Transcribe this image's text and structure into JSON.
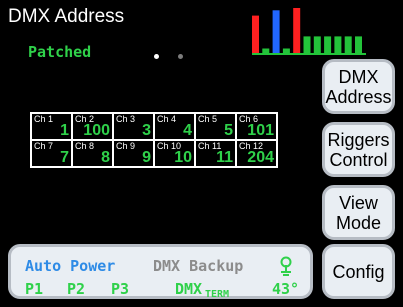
{
  "header": {
    "title": "DMX Address",
    "status": "Patched"
  },
  "page_dots": {
    "count": 2,
    "active": 0
  },
  "level_bars": [
    {
      "level": 0.83,
      "color": "#ff2020"
    },
    {
      "level": 0.1,
      "color": "#23c43a"
    },
    {
      "level": 0.95,
      "color": "#2166ff"
    },
    {
      "level": 0.1,
      "color": "#23c43a"
    },
    {
      "level": 1.0,
      "color": "#ff2020"
    },
    {
      "level": 0.37,
      "color": "#23c43a"
    },
    {
      "level": 0.37,
      "color": "#23c43a"
    },
    {
      "level": 0.37,
      "color": "#23c43a"
    },
    {
      "level": 0.37,
      "color": "#23c43a"
    },
    {
      "level": 0.37,
      "color": "#23c43a"
    },
    {
      "level": 0.37,
      "color": "#23c43a"
    }
  ],
  "channels": [
    {
      "label": "Ch 1",
      "value": "1"
    },
    {
      "label": "Ch 2",
      "value": "100"
    },
    {
      "label": "Ch 3",
      "value": "3"
    },
    {
      "label": "Ch 4",
      "value": "4"
    },
    {
      "label": "Ch 5",
      "value": "5"
    },
    {
      "label": "Ch 6",
      "value": "101"
    },
    {
      "label": "Ch 7",
      "value": "7"
    },
    {
      "label": "Ch 8",
      "value": "8"
    },
    {
      "label": "Ch 9",
      "value": "9"
    },
    {
      "label": "Ch 10",
      "value": "10"
    },
    {
      "label": "Ch 11",
      "value": "11"
    },
    {
      "label": "Ch 12",
      "value": "204"
    }
  ],
  "side_buttons": {
    "dmx_address": [
      "DMX",
      "Address"
    ],
    "riggers_control": [
      "Riggers",
      "Control"
    ],
    "view_mode": [
      "View",
      "Mode"
    ],
    "config": [
      "Config"
    ]
  },
  "status_panel": {
    "auto_power": "Auto Power",
    "dmx_backup": "DMX Backup",
    "p1": "P1",
    "p2": "P2",
    "p3": "P3",
    "dmx": "DMX",
    "term": "TERM",
    "temperature": "43°",
    "thermometer_icon": "thermometer-icon"
  },
  "colors": {
    "accent_green": "#2fd14a",
    "accent_blue": "#2e8be6",
    "inactive_gray": "#8c8c8c",
    "button_bg": "#e9eef3"
  }
}
